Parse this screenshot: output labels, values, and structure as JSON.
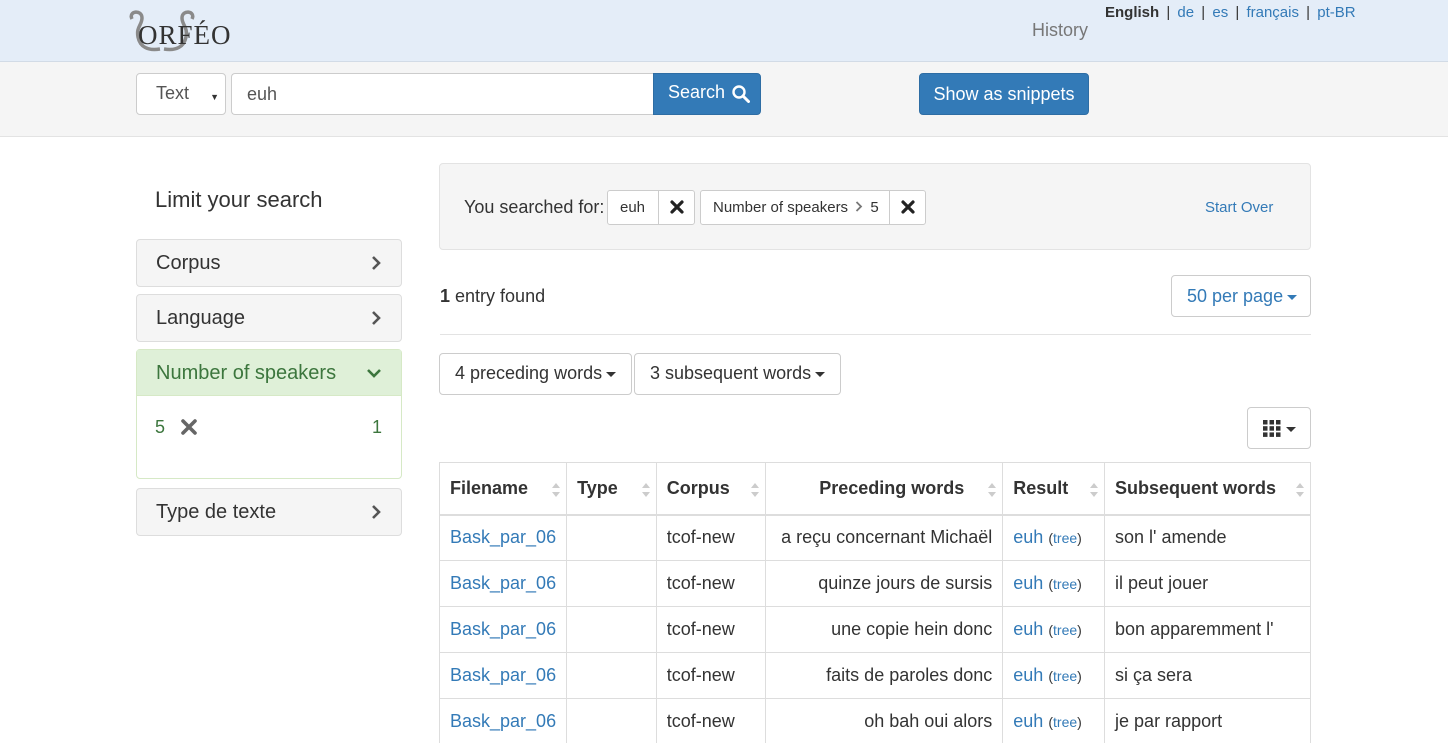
{
  "header": {
    "logo_text": "ORFÉO",
    "history_label": "History",
    "languages": {
      "current": "English",
      "others": [
        "de",
        "es",
        "français",
        "pt-BR"
      ],
      "separator": "|"
    }
  },
  "search": {
    "field_selected": "Text",
    "query": "euh",
    "search_label": "Search",
    "snippets_label": "Show as snippets"
  },
  "sidebar": {
    "title": "Limit your search",
    "facets": [
      {
        "label": "Corpus"
      },
      {
        "label": "Language"
      },
      {
        "label": "Number of speakers",
        "selected_value": "5",
        "count": "1"
      },
      {
        "label": "Type de texte"
      }
    ]
  },
  "constraints": {
    "label": "You searched for:",
    "query_chip": "euh",
    "filter_field": "Number of speakers",
    "filter_value": "5",
    "start_over": "Start Over"
  },
  "results_info": {
    "count": "1",
    "count_text": "entry found",
    "per_page": "50 per page",
    "preceding_words": "4 preceding words",
    "subsequent_words": "3 subsequent words"
  },
  "table": {
    "headers": [
      "Filename",
      "Type",
      "Corpus",
      "Preceding words",
      "Result",
      "Subsequent words"
    ],
    "tree_label": "tree",
    "rows": [
      {
        "filename": "Bask_par_06",
        "type": "",
        "corpus": "tcof-new",
        "preceding": "a reçu concernant Michaël",
        "result": "euh",
        "subsequent": "son l' amende"
      },
      {
        "filename": "Bask_par_06",
        "type": "",
        "corpus": "tcof-new",
        "preceding": "quinze jours de sursis",
        "result": "euh",
        "subsequent": "il peut jouer"
      },
      {
        "filename": "Bask_par_06",
        "type": "",
        "corpus": "tcof-new",
        "preceding": "une copie hein donc",
        "result": "euh",
        "subsequent": "bon apparemment l'"
      },
      {
        "filename": "Bask_par_06",
        "type": "",
        "corpus": "tcof-new",
        "preceding": "faits de paroles donc",
        "result": "euh",
        "subsequent": "si ça sera"
      },
      {
        "filename": "Bask_par_06",
        "type": "",
        "corpus": "tcof-new",
        "preceding": "oh bah oui alors",
        "result": "euh",
        "subsequent": "je par rapport"
      }
    ]
  },
  "colors": {
    "primary": "#337ab7",
    "header_bg": "#e4edf8",
    "active_facet_bg": "#dff0d8",
    "active_facet_text": "#3c763d"
  }
}
